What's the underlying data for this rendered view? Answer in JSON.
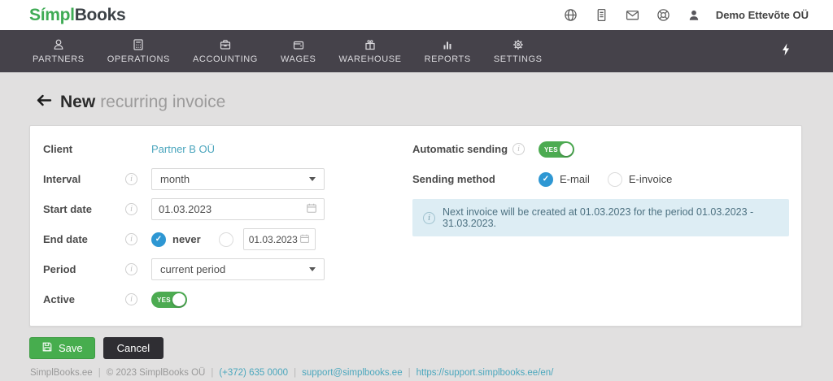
{
  "header": {
    "logo_part1": "Símpl",
    "logo_part2": "Books",
    "toolbar_icons": [
      "globe-icon",
      "document-icon",
      "envelope-icon",
      "support-icon",
      "user-icon"
    ],
    "account": "Demo Ettevõte OÜ"
  },
  "nav": {
    "items": [
      {
        "label": "PARTNERS",
        "icon": "partners-icon"
      },
      {
        "label": "OPERATIONS",
        "icon": "operations-icon"
      },
      {
        "label": "ACCOUNTING",
        "icon": "accounting-icon"
      },
      {
        "label": "WAGES",
        "icon": "wages-icon"
      },
      {
        "label": "WAREHOUSE",
        "icon": "warehouse-icon"
      },
      {
        "label": "REPORTS",
        "icon": "reports-icon"
      },
      {
        "label": "SETTINGS",
        "icon": "settings-icon"
      }
    ],
    "quick_icon": "lightning-icon"
  },
  "page": {
    "title_bold": "New",
    "title_rest": "recurring invoice"
  },
  "form": {
    "client": {
      "label": "Client",
      "value": "Partner B OÜ"
    },
    "interval": {
      "label": "Interval",
      "value": "month"
    },
    "start_date": {
      "label": "Start date",
      "value": "01.03.2023"
    },
    "end_date": {
      "label": "End date",
      "never_label": "never",
      "never_checked": true,
      "date_value": "01.03.2023"
    },
    "period": {
      "label": "Period",
      "value": "current period"
    },
    "active": {
      "label": "Active",
      "toggle_label": "YES",
      "on": true
    },
    "automatic_sending": {
      "label": "Automatic sending",
      "toggle_label": "YES",
      "on": true
    },
    "sending_method": {
      "label": "Sending method",
      "options": [
        {
          "label": "E-mail",
          "selected": true
        },
        {
          "label": "E-invoice",
          "selected": false
        }
      ]
    },
    "notice": "Next invoice will be created at 01.03.2023 for the period 01.03.2023 - 31.03.2023."
  },
  "actions": {
    "save": "Save",
    "cancel": "Cancel"
  },
  "footer": {
    "site": "SimplBooks.ee",
    "copyright": "© 2023 SimplBooks OÜ",
    "phone": "(+372) 635 0000",
    "email": "support@simplbooks.ee",
    "url": "https://support.simplbooks.ee/en/",
    "separator": "|"
  },
  "colors": {
    "brand_green": "#3fab55",
    "navbar_bg": "#45424a",
    "accent_green": "#47ad4e",
    "toggle_green": "#4cab51",
    "radio_blue": "#2e97d3",
    "link_teal": "#4aa5bd",
    "notice_bg": "#ddedf4",
    "page_bg": "#e1e0e0"
  }
}
